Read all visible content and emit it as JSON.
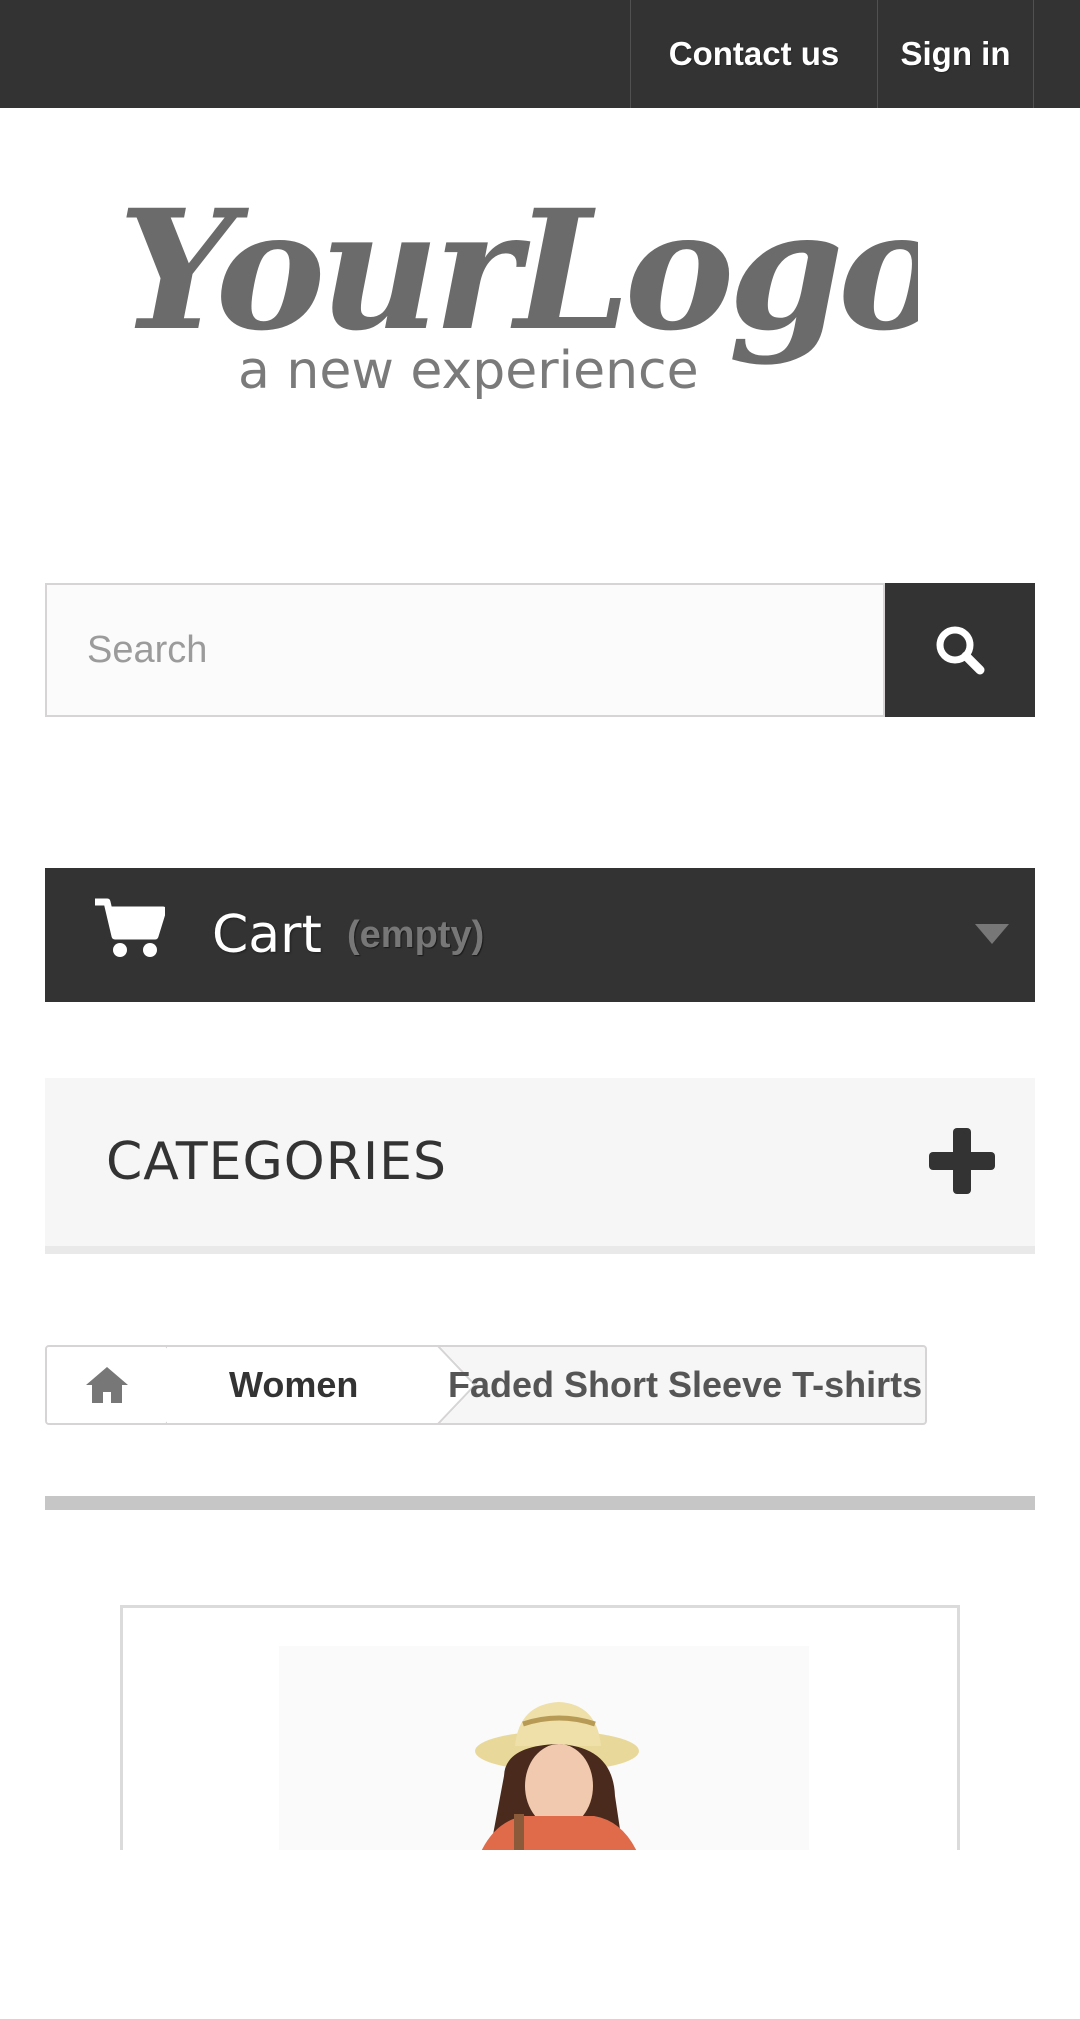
{
  "header": {
    "contact_label": "Contact us",
    "signin_label": "Sign in"
  },
  "logo": {
    "primary": "YourLogo",
    "tagline": "a new experience"
  },
  "search": {
    "placeholder": "Search",
    "icon": "search-icon"
  },
  "cart": {
    "title": "Cart",
    "status": "(empty)",
    "icon": "cart-icon",
    "chevron_icon": "chevron-down-icon"
  },
  "categories": {
    "title": "CATEGORIES",
    "icon": "plus-icon"
  },
  "breadcrumb": {
    "home_icon": "home-icon",
    "items": [
      "Women",
      "Faded Short Sleeve T-shirts"
    ]
  },
  "colors": {
    "dark": "#333333",
    "light_panel": "#f6f6f6",
    "muted_text": "#777777",
    "border": "#d6d4d4"
  }
}
